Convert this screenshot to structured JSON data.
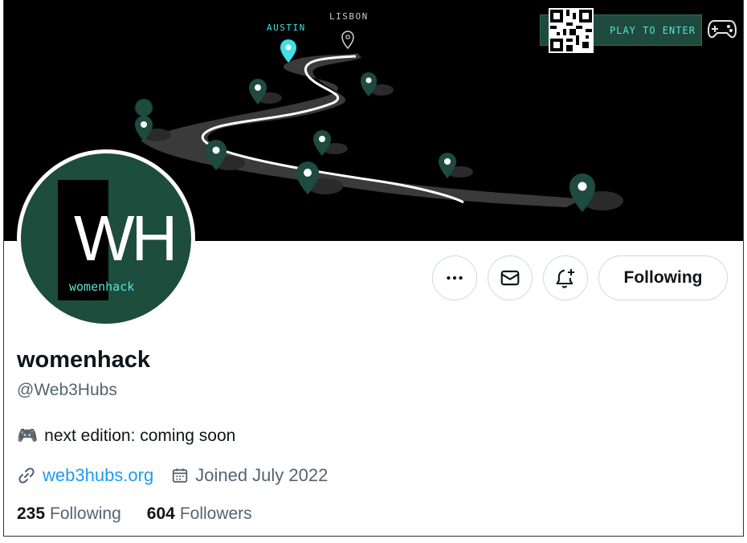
{
  "banner": {
    "city_austin": "AUSTIN",
    "city_lisbon": "LISBON",
    "promo_text": "PLAY TO ENTER"
  },
  "avatar": {
    "monogram": "WH",
    "label": "womenhack"
  },
  "actions": {
    "more_icon": "more-icon",
    "message_icon": "mail-icon",
    "notify_icon": "bell-plus-icon",
    "follow_label": "Following"
  },
  "profile": {
    "display_name": "womenhack",
    "handle": "@Web3Hubs",
    "bio_emoji": "🎮",
    "bio_text": "next edition: coming soon",
    "website": "web3hubs.org",
    "joined": "Joined July 2022"
  },
  "stats": {
    "following_count": "235",
    "following_label": "Following",
    "followers_count": "604",
    "followers_label": "Followers"
  },
  "colors": {
    "accent": "#1d9bf0",
    "brand_green": "#1d4d3c",
    "banner_cyan": "#3fe0e8"
  }
}
